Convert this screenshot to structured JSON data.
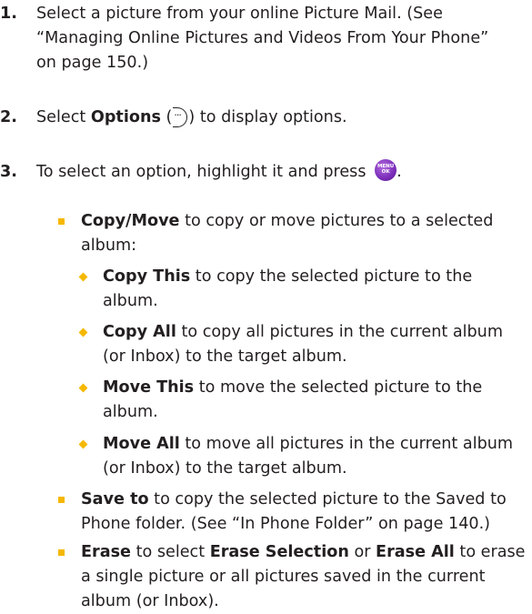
{
  "steps": [
    {
      "num": "1.",
      "text": "Select a picture from your online Picture Mail. (See “Managing Online Pictures and Videos From Your Phone” on page 150.)"
    },
    {
      "num": "2.",
      "pre": "Select ",
      "bold": "Options",
      "post_open": " (",
      "post_close": ") to display options."
    },
    {
      "num": "3.",
      "pre": "To select an option, highlight it and press ",
      "post": "."
    }
  ],
  "icons": {
    "options": "options-softkey-icon",
    "menu_ok": {
      "name": "menu-ok-key-icon",
      "line1": "MENU",
      "line2": "OK",
      "color": "#7a2db8"
    }
  },
  "bullets": {
    "copy_move": {
      "bold": "Copy/Move",
      "text": " to copy or move pictures to a selected album:"
    },
    "copy_this": {
      "bold": "Copy This",
      "text": " to copy the selected picture to the album."
    },
    "copy_all": {
      "bold": "Copy All",
      "text": " to copy all pictures in the current album (or Inbox) to the target album."
    },
    "move_this": {
      "bold": "Move This",
      "text": " to move the selected picture to the album."
    },
    "move_all": {
      "bold": "Move All",
      "text": " to move all pictures in the current album (or Inbox) to the target album."
    },
    "save_to": {
      "bold": "Save to",
      "text": " to copy the selected picture to the Saved to Phone folder. (See “In Phone Folder” on page 140.)"
    },
    "erase": {
      "bold": "Erase",
      "mid1": " to select ",
      "bold2": "Erase Selection",
      "mid2": " or ",
      "bold3": "Erase All",
      "text": " to erase a single picture or all pictures saved in the current album (or Inbox)."
    }
  },
  "colors": {
    "bullet": "#f5b800",
    "text": "#231f20"
  }
}
